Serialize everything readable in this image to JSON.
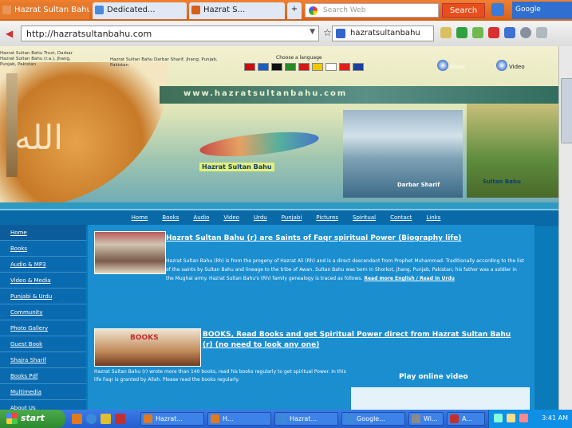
{
  "browser": {
    "tabs": [
      {
        "label": "Hazrat Sultan Bahu"
      },
      {
        "label": "Dedicated..."
      },
      {
        "label": "Hazrat S..."
      }
    ],
    "new_tab_label": "+",
    "search_placeholder": "Search Web",
    "search_button": "Search",
    "toolbar_right_label": "Google",
    "url": "http://hazratsultanbahu.com",
    "search2_value": "hazratsultanbahu"
  },
  "header": {
    "address_left": "Hazrat Sultan Bahu Trust, Darbar Hazrat Sultan Bahu (r.a.), Jhang, Punjab, Pakistan",
    "address_right": "Hazrat Sultan Bahu Darbar Sharif, Jhang, Punjab, Pakistan",
    "languages_label": "Choose a language",
    "flag_colors": [
      "#c81010",
      "#1a5fc0",
      "#101010",
      "#2a8a2a",
      "#d41818",
      "#f0c800",
      "#ffffff",
      "#e02020",
      "#1a3fa0"
    ],
    "music_label": "Music",
    "video_label": "Video",
    "band_text": "www.hazratsultanbahu.com",
    "swirl_caption": "Hazrat Sultan Bahu",
    "caption1": "Darbar Sharif",
    "caption2": "Sultan Bahu"
  },
  "topnav": [
    "Home",
    "Books",
    "Audio",
    "Video",
    "Urdu",
    "Punjabi",
    "Pictures",
    "Spiritual",
    "Contact",
    "Links"
  ],
  "sidebar": [
    "Home",
    "Books",
    "Audio & MP3",
    "Video & Media",
    "Punjabi & Urdu",
    "Community",
    "Photo Gallery",
    "Guest Book",
    "Shajra Sharif",
    "Books Pdf",
    "Multimedia",
    "About Us"
  ],
  "main": {
    "article1_title": "Hazrat Sultan Bahu (r) are Saints of Faqr spiritual Power (Biography life)",
    "article1_body": "Hazrat Sultan Bahu (Rh) is from the progeny of Hazrat Ali (Rh) and is a direct descendant from Prophet Muhammad. Traditionally according to the list of the saints by Sultan Bahu and lineage to the tribe of Awan. Sultan Bahu was born in Shorkot, Jhang, Punjab, Pakistan; his father was a soldier in the Mughal army. Hazrat Sultan Bahu's (Rh) family genealogy is traced as follows.",
    "article1_more": "Read more English / Read in Urdu",
    "thumb2_label": "BOOKS",
    "article2_title": "BOOKS, Read Books and get Spiritual Power direct from Hazrat Sultan Bahu (r) (no need to look any one)",
    "article2_body": "Hazrat Sultan Bahu (r) wrote more than 140 books, read his books regularly to get spiritual Power. In this life Faqr is granted by Allah. Please read the books regularly.",
    "play_label": "Play online video"
  },
  "taskbar": {
    "start_label": "start",
    "buttons": [
      "Hazrat...",
      "H...",
      "Hazrat...",
      "Google...",
      "Wi...",
      "A..."
    ],
    "clock": "3:41 AM"
  }
}
